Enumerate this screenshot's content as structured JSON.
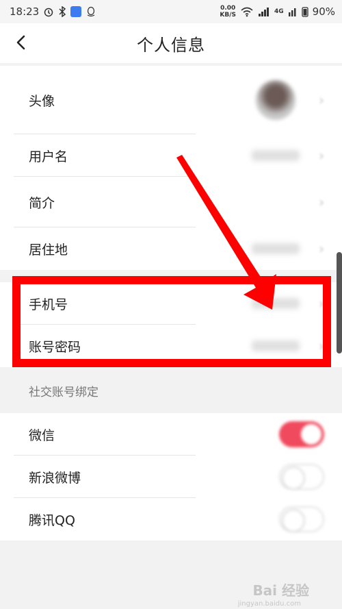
{
  "status_bar": {
    "time": "18:23",
    "net_speed_value": "0.00",
    "net_speed_unit": "KB/S",
    "network_type": "4G",
    "battery": "90%"
  },
  "nav": {
    "title": "个人信息"
  },
  "profile": {
    "avatar_label": "头像",
    "username_label": "用户名",
    "intro_label": "简介",
    "location_label": "居住地"
  },
  "account": {
    "phone_label": "手机号",
    "password_label": "账号密码"
  },
  "social": {
    "section_title": "社交账号绑定",
    "wechat_label": "微信",
    "wechat_bound": true,
    "weibo_label": "新浪微博",
    "weibo_bound": false,
    "qq_label": "腾讯QQ",
    "qq_bound": false
  },
  "colors": {
    "highlight": "#ff0000",
    "toggle_on": "#f04a5e"
  },
  "watermark": {
    "text": "Bai 经验",
    "sub": "jingyan.baidu.com"
  }
}
